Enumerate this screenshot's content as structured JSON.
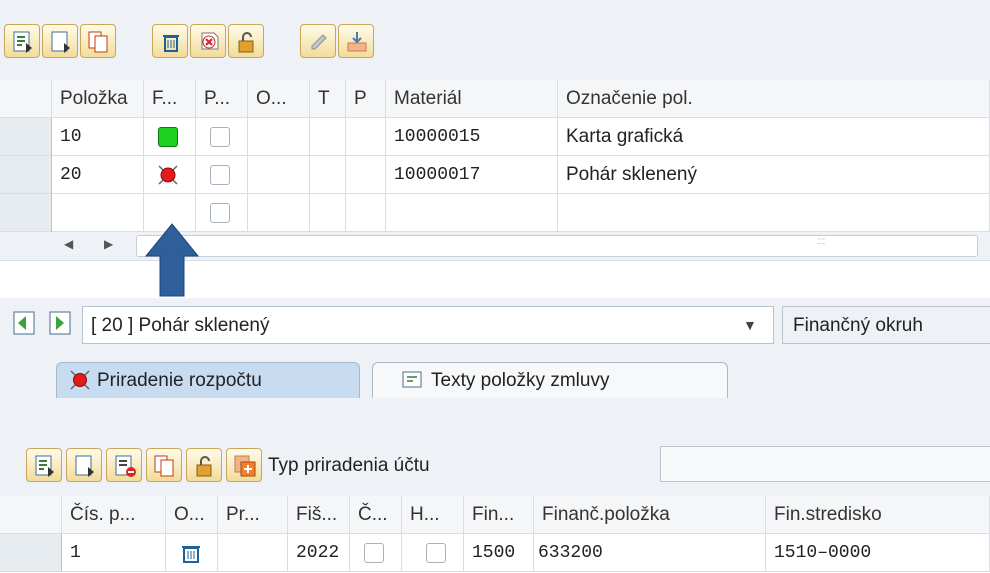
{
  "toolbar": {
    "icons": [
      "select-all-icon",
      "deselect-all-icon",
      "copy-icon",
      "delete-icon",
      "cancel-icon",
      "lock-icon",
      "edit-icon",
      "import-icon"
    ]
  },
  "items_table": {
    "columns": [
      "Položka",
      "F...",
      "P...",
      "O...",
      "T",
      "P",
      "Materiál",
      "Označenie pol."
    ],
    "rows": [
      {
        "item": "10",
        "status": "green",
        "material": "10000015",
        "desc": "Karta grafická"
      },
      {
        "item": "20",
        "status": "red",
        "material": "10000017",
        "desc": "Pohár sklenený"
      },
      {
        "item": "",
        "status": "",
        "material": "",
        "desc": ""
      }
    ]
  },
  "scroll": {
    "left_arrow": "◀",
    "right_arrow": "▶",
    "grip": ":::"
  },
  "detail": {
    "selected_item": "[ 20 ] Pohár sklenený",
    "right_label": "Finančný okruh"
  },
  "tabs": [
    {
      "label": "Priradenie rozpočtu",
      "icon": "red-status-icon",
      "active": true
    },
    {
      "label": "Texty položky zmluvy",
      "icon": "text-icon",
      "active": false
    }
  ],
  "lower_toolbar": {
    "account_assignment_label": "Typ priradenia účtu",
    "account_assignment_value": ""
  },
  "budget_table": {
    "columns": [
      "Čís. p...",
      "O...",
      "Pr...",
      "Fiš...",
      "Č...",
      "H...",
      "Fin...",
      "Finanč.položka",
      "Fin.stredisko"
    ],
    "rows": [
      {
        "num": "1",
        "year": "2022",
        "fin": "1500",
        "fin_item": "633200",
        "fin_center": "1510–0000"
      }
    ]
  },
  "colors": {
    "accent": "#2f5f9a",
    "status_green": "#1fd11f",
    "status_red": "#e21b1b",
    "header_bg": "#f4f6f8"
  }
}
